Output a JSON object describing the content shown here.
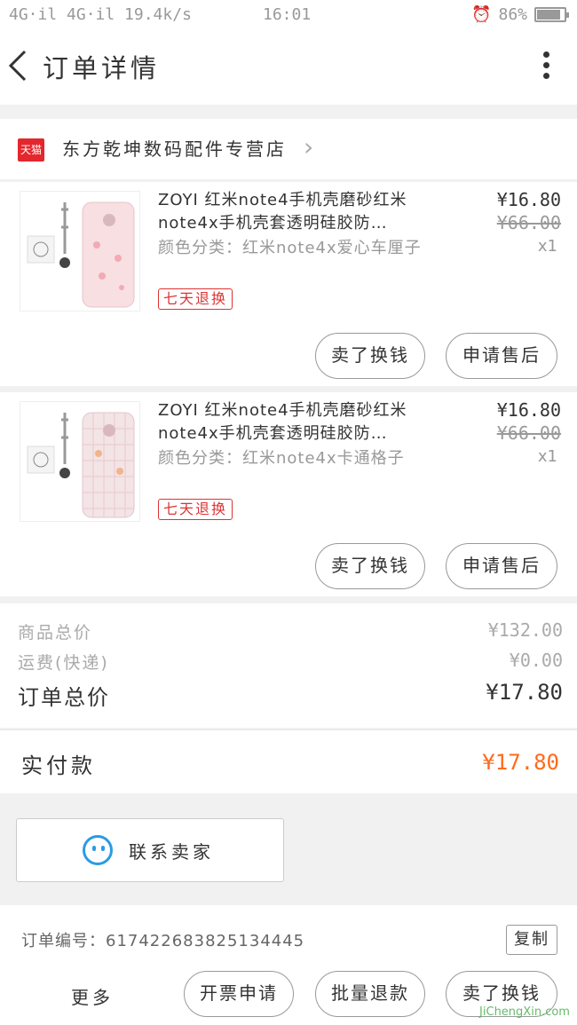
{
  "status_bar": {
    "signal": "4G·il 4G·il 19.4k/s",
    "time": "16:01",
    "battery": "86%"
  },
  "header": {
    "title": "订单详情"
  },
  "shop": {
    "badge": "天猫",
    "name": "东方乾坤数码配件专营店"
  },
  "items": [
    {
      "title": "ZOYI 红米note4手机壳磨砂红米note4x手机壳套透明硅胶防…",
      "sku": "颜色分类：红米note4x爱心车厘子",
      "badge": "七天退换",
      "price": "¥16.80",
      "original_price": "¥66.00",
      "qty": "x1",
      "actions": [
        "卖了换钱",
        "申请售后"
      ]
    },
    {
      "title": "ZOYI 红米note4手机壳磨砂红米note4x手机壳套透明硅胶防…",
      "sku": "颜色分类：红米note4x卡通格子",
      "badge": "七天退换",
      "price": "¥16.80",
      "original_price": "¥66.00",
      "qty": "x1",
      "actions": [
        "卖了换钱",
        "申请售后"
      ]
    }
  ],
  "summary": {
    "goods_total_label": "商品总价",
    "goods_total": "¥132.00",
    "shipping_label": "运费(快递)",
    "shipping": "¥0.00",
    "order_total_label": "订单总价",
    "order_total": "¥17.80"
  },
  "payment": {
    "label": "实付款",
    "amount": "¥17.80"
  },
  "contact": {
    "label": "联系卖家"
  },
  "order": {
    "number_label": "订单编号：617422683825134445",
    "copy_label": "复制"
  },
  "bottom_bar": {
    "more_label": "更多",
    "buttons": [
      "开票申请",
      "批量退款",
      "卖了换钱"
    ]
  },
  "watermark": {
    "text": "JiChengXin.com"
  },
  "colors": {
    "accent": "#ff6a1a",
    "tmall": "#e4262d",
    "badge": "#dd3333",
    "contact": "#2a9be5"
  }
}
